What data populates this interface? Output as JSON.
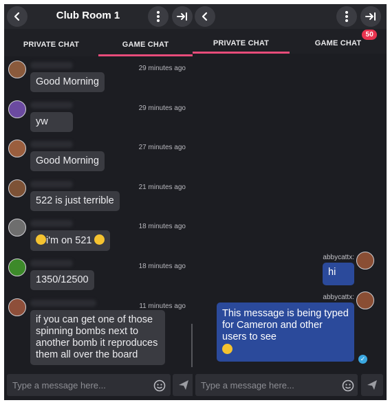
{
  "left": {
    "title": "Club Room 1",
    "tabs": [
      {
        "label": "PRIVATE CHAT"
      },
      {
        "label": "GAME CHAT"
      }
    ],
    "messages": [
      {
        "time": "29 minutes ago",
        "text": "Good Morning"
      },
      {
        "time": "29 minutes ago",
        "text": "yw"
      },
      {
        "time": "27 minutes ago",
        "text": "Good Morning"
      },
      {
        "time": "21 minutes ago",
        "text": "522 is just terrible"
      },
      {
        "time": "18 minutes ago",
        "text": "i'm on 521"
      },
      {
        "time": "18 minutes ago",
        "text": "1350/12500"
      },
      {
        "time": "11 minutes ago",
        "text": "if you can get one of those spinning bombs next to another bomb it reproduces them all over the board"
      }
    ],
    "input_placeholder": "Type a message here..."
  },
  "right": {
    "tabs": [
      {
        "label": "PRIVATE CHAT"
      },
      {
        "label": "GAME CHAT",
        "badge": "50"
      }
    ],
    "messages": [
      {
        "user": "abbycattx:",
        "text": "hi"
      },
      {
        "user": "abbycattx:",
        "text": "This message is being typed for Cameron and other users to see"
      }
    ],
    "input_placeholder": "Type a message here..."
  },
  "colors": {
    "accent": "#e84c7a",
    "own_bubble": "#2b4a9b",
    "badge": "#e8344f",
    "panel_bg": "#1c1d22"
  },
  "icons": [
    "back-arrow-icon",
    "more-vertical-icon",
    "exit-icon",
    "emoji-icon",
    "send-icon",
    "check-icon"
  ]
}
